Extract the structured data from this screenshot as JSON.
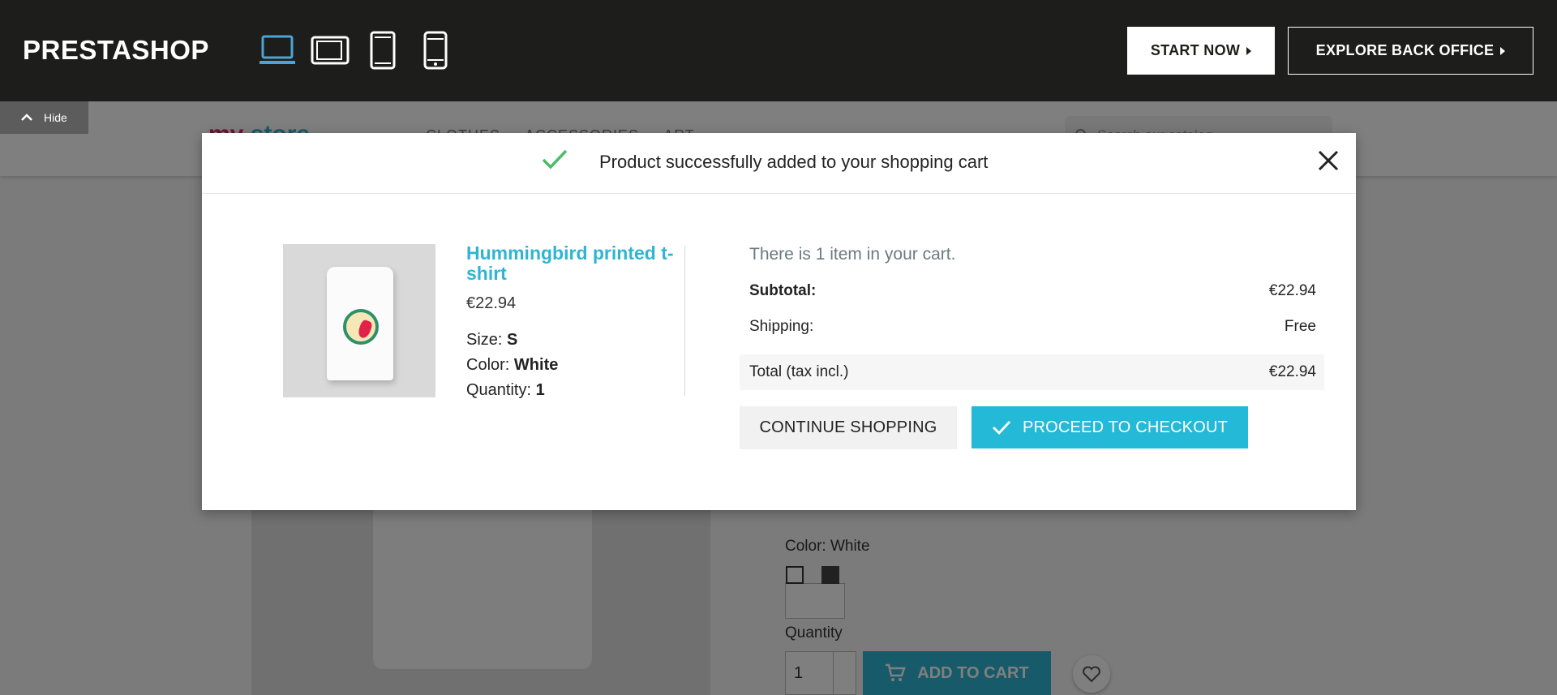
{
  "topbar": {
    "brand": "PRESTASHOP",
    "devices": [
      {
        "icon": "laptop-icon",
        "active": true
      },
      {
        "icon": "tablet-landscape-icon",
        "active": false
      },
      {
        "icon": "tablet-portrait-icon",
        "active": false
      },
      {
        "icon": "mobile-icon",
        "active": false
      }
    ],
    "start_label": "START NOW",
    "explore_label": "EXPLORE BACK OFFICE",
    "hide_label": "Hide",
    "accent": "#4da3d6",
    "background": "#1d1d1b"
  },
  "store": {
    "color_label": "Color: White",
    "quantity_label": "Quantity",
    "quantity_value": "1",
    "add_to_cart": "ADD TO CART",
    "accent": "#2fb5d2"
  },
  "modal": {
    "title": "Product successfully added to your shopping cart",
    "product": {
      "name": "Hummingbird printed t-shirt",
      "price": "€22.94",
      "size_label": "Size:",
      "size_value": "S",
      "color_label": "Color:",
      "color_value": "White",
      "quantity_label": "Quantity:",
      "quantity_value": "1"
    },
    "cart": {
      "count_text": "There is 1 item in your cart.",
      "subtotal_label": "Subtotal:",
      "subtotal_value": "€22.94",
      "shipping_label": "Shipping:",
      "shipping_value": "Free",
      "total_label": "Total (tax incl.)",
      "total_value": "€22.94"
    },
    "continue_label": "CONTINUE SHOPPING",
    "checkout_label": "PROCEED TO CHECKOUT",
    "success_color": "#4cbb6c"
  }
}
